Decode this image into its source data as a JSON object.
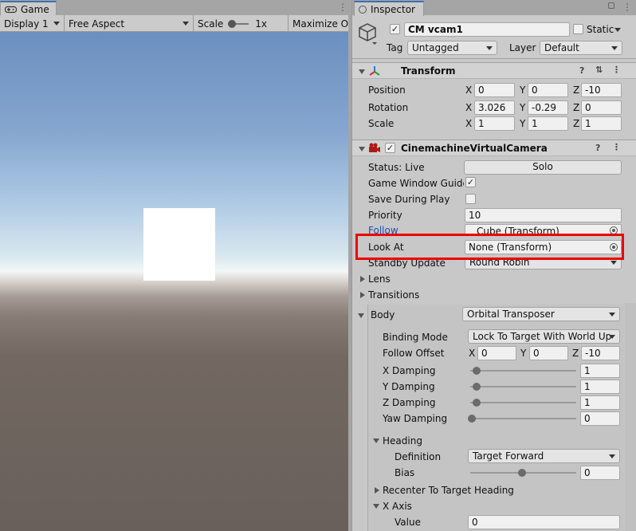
{
  "game": {
    "tab_label": "Game",
    "toolbar": {
      "display": "Display 1",
      "aspect": "Free Aspect",
      "scale_label": "Scale",
      "scale_value": "1x",
      "maximize": "Maximize On"
    }
  },
  "inspector": {
    "tab_label": "Inspector",
    "object": {
      "name": "CM vcam1",
      "enabled": true,
      "static_label": "Static",
      "tag_label": "Tag",
      "tag_value": "Untagged",
      "layer_label": "Layer",
      "layer_value": "Default"
    },
    "transform": {
      "title": "Transform",
      "position_label": "Position",
      "rotation_label": "Rotation",
      "scale_label": "Scale",
      "position": {
        "x": "0",
        "y": "0",
        "z": "-10"
      },
      "rotation": {
        "x": "3.026",
        "y": "-0.29",
        "z": "0"
      },
      "scale": {
        "x": "1",
        "y": "1",
        "z": "1"
      }
    },
    "axis_labels": {
      "x": "X",
      "y": "Y",
      "z": "Z"
    },
    "vcam": {
      "title": "CinemachineVirtualCamera",
      "status_label": "Status: Live",
      "solo_label": "Solo",
      "game_window_guides_label": "Game Window Guides",
      "game_window_guides_checked": true,
      "save_during_play_label": "Save During Play",
      "save_during_play_checked": false,
      "priority_label": "Priority",
      "priority_value": "10",
      "follow_label": "Follow",
      "follow_value": "Cube (Transform)",
      "look_at_label": "Look At",
      "look_at_value": "None (Transform)",
      "standby_label": "Standby Update",
      "standby_value": "Round Robin",
      "lens_label": "Lens",
      "transitions_label": "Transitions"
    },
    "body": {
      "label": "Body",
      "value": "Orbital Transposer",
      "binding_mode_label": "Binding Mode",
      "binding_mode_value": "Lock To Target With World Up",
      "follow_offset_label": "Follow Offset",
      "follow_offset": {
        "x": "0",
        "y": "0",
        "z": "-10"
      },
      "x_damping_label": "X Damping",
      "x_damping_value": "1",
      "y_damping_label": "Y Damping",
      "y_damping_value": "1",
      "z_damping_label": "Z Damping",
      "z_damping_value": "1",
      "yaw_damping_label": "Yaw Damping",
      "yaw_damping_value": "0",
      "heading_label": "Heading",
      "definition_label": "Definition",
      "definition_value": "Target Forward",
      "bias_label": "Bias",
      "bias_value": "0",
      "recenter_label": "Recenter To Target Heading",
      "x_axis_label": "X Axis",
      "value_label": "Value",
      "value_value": "0"
    }
  }
}
